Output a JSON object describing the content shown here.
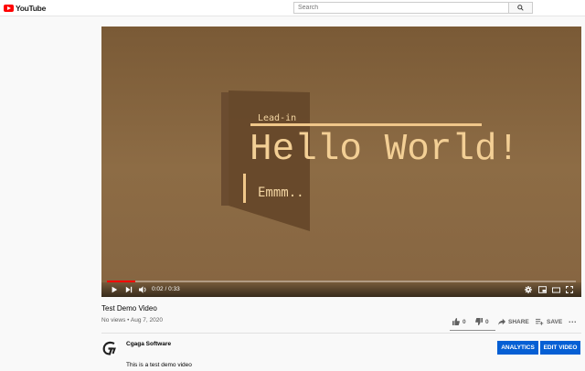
{
  "header": {
    "logo_text": "YouTube",
    "search_placeholder": "Search"
  },
  "player": {
    "overlay": {
      "lead_in": "Lead-in",
      "headline": "Hello World!",
      "subtext": "Emmm.."
    },
    "time_current": "0:02",
    "time_total": "0:33",
    "time_display": "0:02 / 0:33",
    "progress_fraction": 0.06
  },
  "video": {
    "title": "Test Demo Video",
    "meta": "No views • Aug 7, 2020",
    "likes": "0",
    "dislikes": "0",
    "share_label": "SHARE",
    "save_label": "SAVE",
    "more_label": "..."
  },
  "channel": {
    "name": "Cgaga Software",
    "analytics_label": "ANALYTICS",
    "edit_label": "EDIT VIDEO",
    "description": "This is a test demo video"
  },
  "colors": {
    "brand_red": "#ff0000",
    "accent_blue": "#065fd4"
  },
  "icons": [
    "youtube-logo-icon",
    "search-icon",
    "play-icon",
    "next-icon",
    "volume-icon",
    "settings-icon",
    "miniplayer-icon",
    "theater-icon",
    "fullscreen-icon",
    "thumbs-up-icon",
    "thumbs-down-icon",
    "share-icon",
    "save-icon",
    "more-icon"
  ]
}
